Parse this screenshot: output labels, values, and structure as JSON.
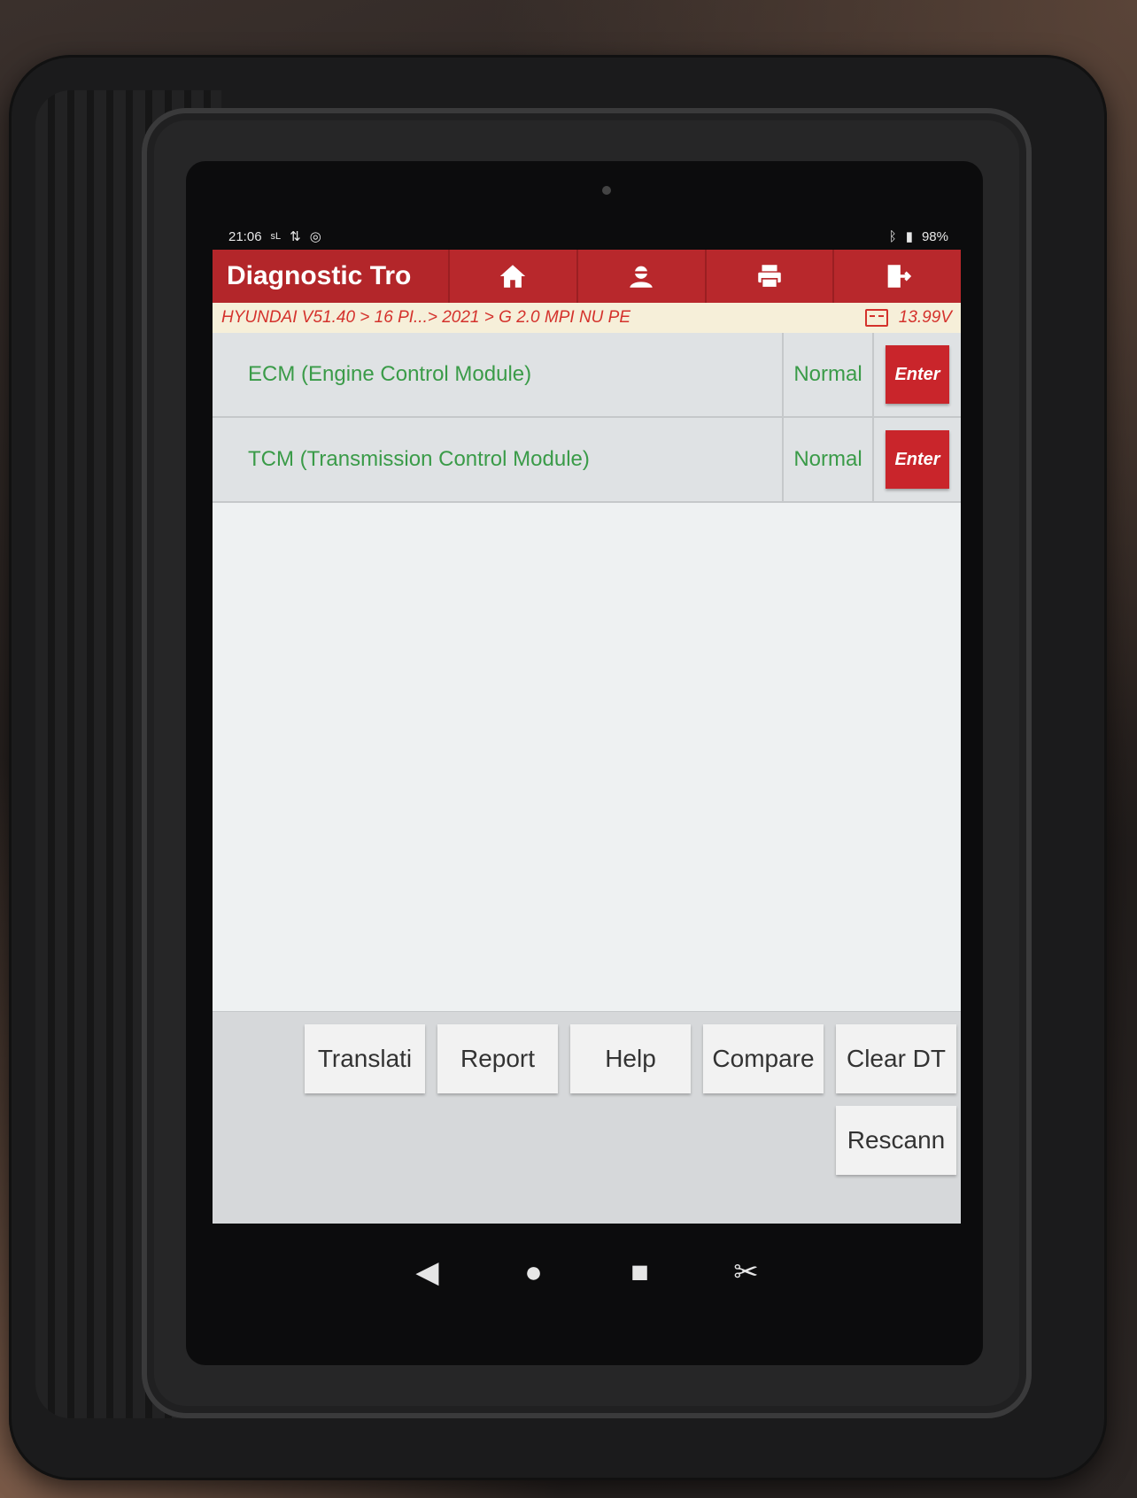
{
  "status_bar": {
    "time": "21:06",
    "signal_text": "sL",
    "usb_icon": "usb-icon",
    "shield_icon": "settings-circle-icon",
    "bluetooth_icon": "bluetooth-icon",
    "battery_percent": "98%"
  },
  "header": {
    "title": "Diagnostic Tro",
    "buttons": [
      {
        "name": "home",
        "icon": "home-icon"
      },
      {
        "name": "user",
        "icon": "user-icon"
      },
      {
        "name": "print",
        "icon": "printer-icon"
      },
      {
        "name": "exit",
        "icon": "exit-icon"
      }
    ]
  },
  "breadcrumb": {
    "path": "HYUNDAI V51.40 > 16 PI...> 2021 > G 2.0 MPI NU PE",
    "voltage": "13.99V"
  },
  "modules": [
    {
      "name": "ECM (Engine Control Module)",
      "status": "Normal",
      "action": "Enter"
    },
    {
      "name": "TCM (Transmission Control Module)",
      "status": "Normal",
      "action": "Enter"
    }
  ],
  "bottom_buttons": {
    "translate": "Translati",
    "report": "Report",
    "help": "Help",
    "compare": "Compare",
    "clear": "Clear DT",
    "rescan": "Rescann"
  },
  "nav": {
    "back": "◀",
    "home": "●",
    "recents": "■",
    "screenshot": "✂"
  },
  "colors": {
    "header_red": "#b3262a",
    "status_green": "#3a9b48",
    "breadcrumb_text": "#d4322c"
  }
}
